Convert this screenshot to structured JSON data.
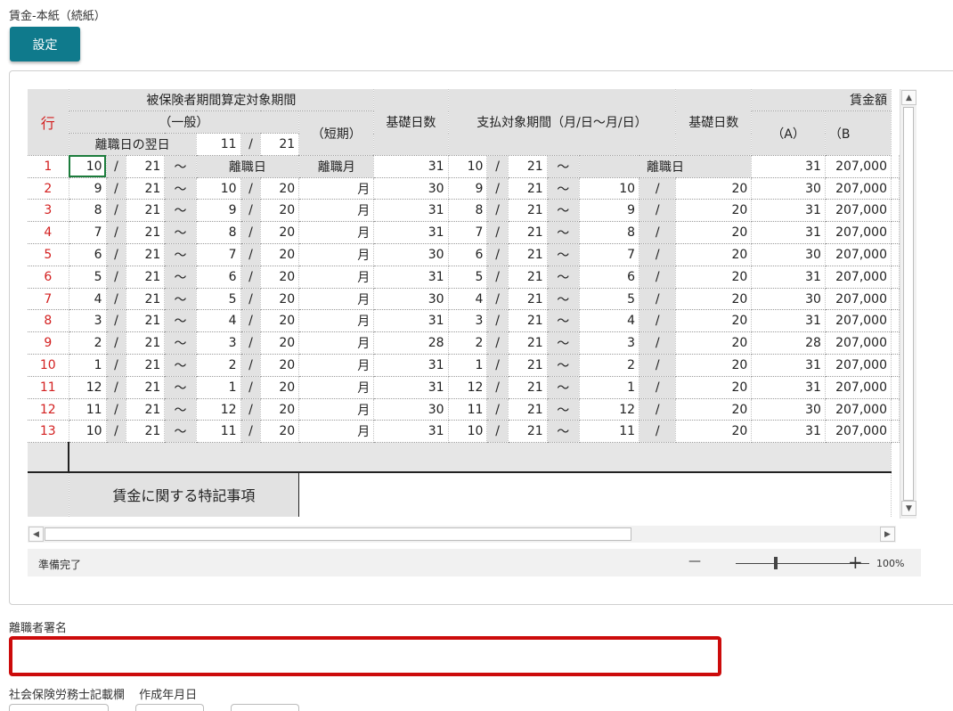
{
  "page": {
    "title": "賃金-本紙（続紙）",
    "settings_button": "設定",
    "signature_label": "離職者署名",
    "sharoushi_label": "社会保険労務士記載欄",
    "created_date_label": "作成年月日"
  },
  "sheet": {
    "header": {
      "row_label": "行",
      "insured_period": "被保険者期間算定対象期間",
      "general": "（一般）",
      "short_term": "（短期）",
      "day_after_leaving": "離職日の翌日",
      "day_after_month": "11",
      "day_after_day": "21",
      "slash": "/",
      "base_days_1": "基礎日数",
      "payment_period": "支払対象期間（月/日～月/日）",
      "base_days_2": "基礎日数",
      "wage_amount": "賃金額",
      "col_a": "（A）",
      "col_b": "（B"
    },
    "rows": [
      {
        "n": "1",
        "fm": "10",
        "fd": "21",
        "tm": "離職日",
        "td": "",
        "sm": "離職月",
        "bd": "31",
        "pfm": "10",
        "pfd": "21",
        "ptm": "離職日",
        "ptd": "",
        "bd2": "31",
        "a": "207,000"
      },
      {
        "n": "2",
        "fm": "9",
        "fd": "21",
        "tm": "10",
        "td": "20",
        "sm": "月",
        "bd": "30",
        "pfm": "9",
        "pfd": "21",
        "ptm": "10",
        "ptd": "20",
        "bd2": "30",
        "a": "207,000"
      },
      {
        "n": "3",
        "fm": "8",
        "fd": "21",
        "tm": "9",
        "td": "20",
        "sm": "月",
        "bd": "31",
        "pfm": "8",
        "pfd": "21",
        "ptm": "9",
        "ptd": "20",
        "bd2": "31",
        "a": "207,000"
      },
      {
        "n": "4",
        "fm": "7",
        "fd": "21",
        "tm": "8",
        "td": "20",
        "sm": "月",
        "bd": "31",
        "pfm": "7",
        "pfd": "21",
        "ptm": "8",
        "ptd": "20",
        "bd2": "31",
        "a": "207,000"
      },
      {
        "n": "5",
        "fm": "6",
        "fd": "21",
        "tm": "7",
        "td": "20",
        "sm": "月",
        "bd": "30",
        "pfm": "6",
        "pfd": "21",
        "ptm": "7",
        "ptd": "20",
        "bd2": "30",
        "a": "207,000"
      },
      {
        "n": "6",
        "fm": "5",
        "fd": "21",
        "tm": "6",
        "td": "20",
        "sm": "月",
        "bd": "31",
        "pfm": "5",
        "pfd": "21",
        "ptm": "6",
        "ptd": "20",
        "bd2": "31",
        "a": "207,000"
      },
      {
        "n": "7",
        "fm": "4",
        "fd": "21",
        "tm": "5",
        "td": "20",
        "sm": "月",
        "bd": "30",
        "pfm": "4",
        "pfd": "21",
        "ptm": "5",
        "ptd": "20",
        "bd2": "30",
        "a": "207,000"
      },
      {
        "n": "8",
        "fm": "3",
        "fd": "21",
        "tm": "4",
        "td": "20",
        "sm": "月",
        "bd": "31",
        "pfm": "3",
        "pfd": "21",
        "ptm": "4",
        "ptd": "20",
        "bd2": "31",
        "a": "207,000"
      },
      {
        "n": "9",
        "fm": "2",
        "fd": "21",
        "tm": "3",
        "td": "20",
        "sm": "月",
        "bd": "28",
        "pfm": "2",
        "pfd": "21",
        "ptm": "3",
        "ptd": "20",
        "bd2": "28",
        "a": "207,000"
      },
      {
        "n": "10",
        "fm": "1",
        "fd": "21",
        "tm": "2",
        "td": "20",
        "sm": "月",
        "bd": "31",
        "pfm": "1",
        "pfd": "21",
        "ptm": "2",
        "ptd": "20",
        "bd2": "31",
        "a": "207,000"
      },
      {
        "n": "11",
        "fm": "12",
        "fd": "21",
        "tm": "1",
        "td": "20",
        "sm": "月",
        "bd": "31",
        "pfm": "12",
        "pfd": "21",
        "ptm": "1",
        "ptd": "20",
        "bd2": "31",
        "a": "207,000"
      },
      {
        "n": "12",
        "fm": "11",
        "fd": "21",
        "tm": "12",
        "td": "20",
        "sm": "月",
        "bd": "30",
        "pfm": "11",
        "pfd": "21",
        "ptm": "12",
        "ptd": "20",
        "bd2": "30",
        "a": "207,000"
      },
      {
        "n": "13",
        "fm": "10",
        "fd": "21",
        "tm": "11",
        "td": "20",
        "sm": "月",
        "bd": "31",
        "pfm": "10",
        "pfd": "21",
        "ptm": "11",
        "ptd": "20",
        "bd2": "31",
        "a": "207,000"
      }
    ],
    "slash": "/",
    "tilde": "～",
    "remarks_label": "賃金に関する特記事項"
  },
  "status": {
    "ready": "準備完了",
    "zoom_minus": "—",
    "zoom_plus": "+",
    "zoom_level": "100%"
  },
  "scrollbar": {
    "up": "▲",
    "down": "▼",
    "left": "◀",
    "right": "▶"
  }
}
